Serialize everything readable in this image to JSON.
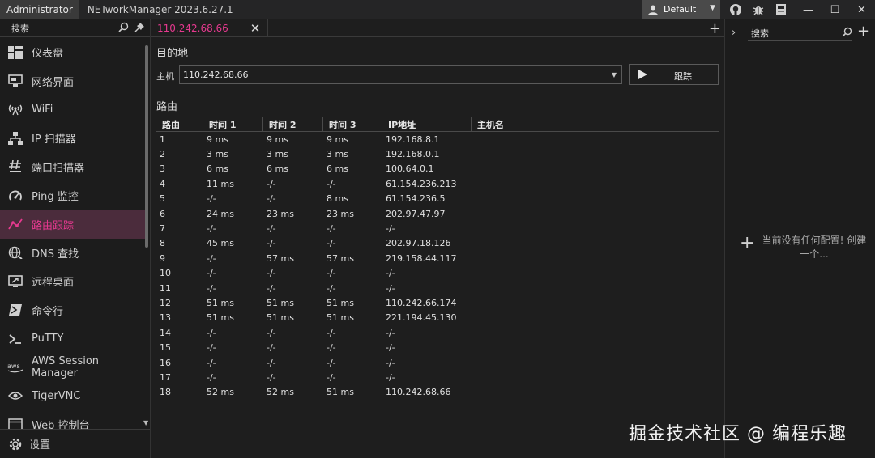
{
  "titlebar": {
    "admin": "Administrator",
    "app_title": "NETworkManager 2023.6.27.1",
    "profile": "Default"
  },
  "sidebar": {
    "search_placeholder": "搜索",
    "items": [
      {
        "label": "仪表盘",
        "icon": "dashboard-icon"
      },
      {
        "label": "网络界面",
        "icon": "network-interface-icon"
      },
      {
        "label": "WiFi",
        "icon": "wifi-icon"
      },
      {
        "label": "IP 扫描器",
        "icon": "ip-scanner-icon"
      },
      {
        "label": "端口扫描器",
        "icon": "port-scanner-icon"
      },
      {
        "label": "Ping 监控",
        "icon": "ping-monitor-icon"
      },
      {
        "label": "路由跟踪",
        "icon": "traceroute-icon",
        "active": true
      },
      {
        "label": "DNS 查找",
        "icon": "dns-lookup-icon"
      },
      {
        "label": "远程桌面",
        "icon": "remote-desktop-icon"
      },
      {
        "label": "命令行",
        "icon": "powershell-icon"
      },
      {
        "label": "PuTTY",
        "icon": "putty-icon"
      },
      {
        "label": "AWS Session Manager",
        "icon": "aws-icon"
      },
      {
        "label": "TigerVNC",
        "icon": "vnc-icon"
      },
      {
        "label": "Web 控制台",
        "icon": "web-console-icon"
      }
    ],
    "settings_label": "设置"
  },
  "tab": {
    "label": "110.242.68.66"
  },
  "destination": {
    "title": "目的地",
    "host_label": "主机",
    "host_value": "110.242.68.66",
    "trace_button": "跟踪"
  },
  "route": {
    "title": "路由",
    "columns": [
      "路由",
      "时间 1",
      "时间 2",
      "时间 3",
      "IP地址",
      "主机名"
    ],
    "rows": [
      [
        "1",
        "9 ms",
        "9 ms",
        "9 ms",
        "192.168.8.1",
        ""
      ],
      [
        "2",
        "3 ms",
        "3 ms",
        "3 ms",
        "192.168.0.1",
        ""
      ],
      [
        "3",
        "6 ms",
        "6 ms",
        "6 ms",
        "100.64.0.1",
        ""
      ],
      [
        "4",
        "11 ms",
        "-/-",
        "-/-",
        "61.154.236.213",
        ""
      ],
      [
        "5",
        "-/-",
        "-/-",
        "8 ms",
        "61.154.236.5",
        ""
      ],
      [
        "6",
        "24 ms",
        "23 ms",
        "23 ms",
        "202.97.47.97",
        ""
      ],
      [
        "7",
        "-/-",
        "-/-",
        "-/-",
        "-/-",
        ""
      ],
      [
        "8",
        "45 ms",
        "-/-",
        "-/-",
        "202.97.18.126",
        ""
      ],
      [
        "9",
        "-/-",
        "57 ms",
        "57 ms",
        "219.158.44.117",
        ""
      ],
      [
        "10",
        "-/-",
        "-/-",
        "-/-",
        "-/-",
        ""
      ],
      [
        "11",
        "-/-",
        "-/-",
        "-/-",
        "-/-",
        ""
      ],
      [
        "12",
        "51 ms",
        "51 ms",
        "51 ms",
        "110.242.66.174",
        ""
      ],
      [
        "13",
        "51 ms",
        "51 ms",
        "51 ms",
        "221.194.45.130",
        ""
      ],
      [
        "14",
        "-/-",
        "-/-",
        "-/-",
        "-/-",
        ""
      ],
      [
        "15",
        "-/-",
        "-/-",
        "-/-",
        "-/-",
        ""
      ],
      [
        "16",
        "-/-",
        "-/-",
        "-/-",
        "-/-",
        ""
      ],
      [
        "17",
        "-/-",
        "-/-",
        "-/-",
        "-/-",
        ""
      ],
      [
        "18",
        "52 ms",
        "52 ms",
        "51 ms",
        "110.242.68.66",
        ""
      ]
    ]
  },
  "profiles_panel": {
    "search_placeholder": "搜索",
    "empty_text": "当前没有任何配置! 创建一个..."
  },
  "watermark": "掘金技术社区 @ 编程乐趣",
  "colors": {
    "accent": "#e6398f",
    "background": "#1e1e1e",
    "active_row": "#4b2c3c"
  }
}
